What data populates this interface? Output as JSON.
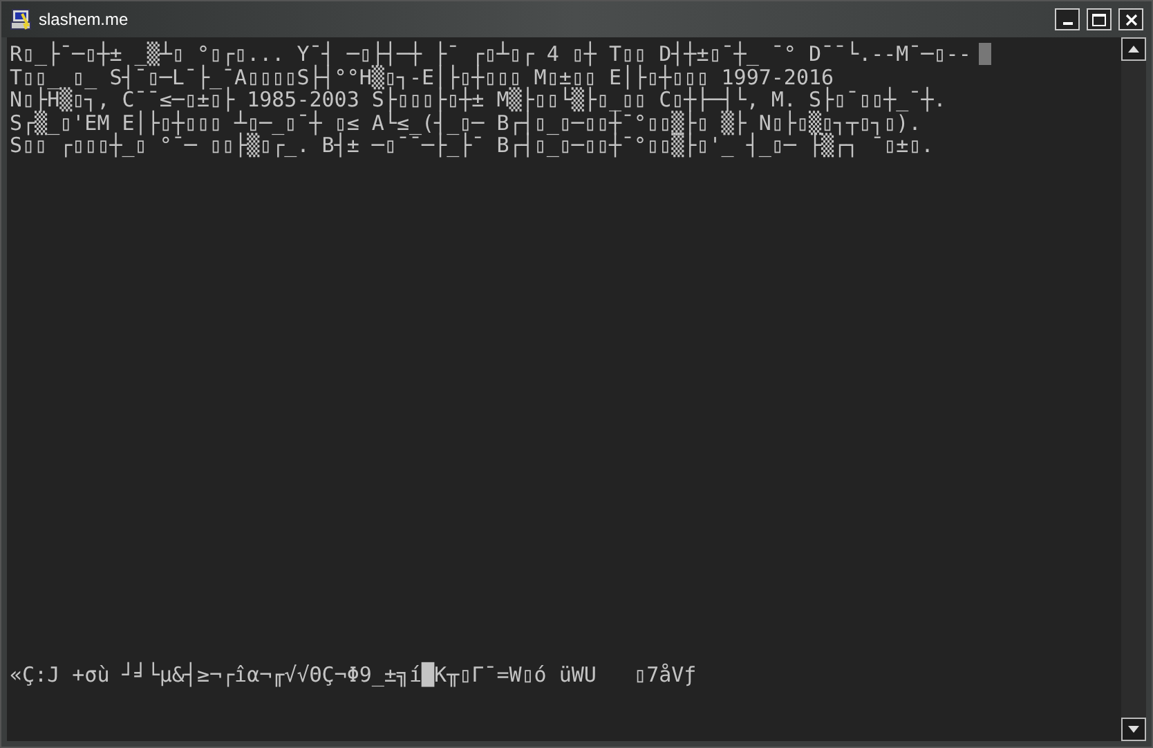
{
  "window": {
    "title": "slashem.me"
  },
  "terminal": {
    "lines": [
      "R▯_├¯─▯┼± _▒┴▯ °▯┌▯... Y¯┤ ─▯├┤─┼ ├¯ ┌▯┴▯┌ 4 ▯┼ T▯▯ D┤┼±▯¯┼_ ¯° D¯¯└.--M¯─▯--",
      "T▯▯_ ▯_ S┤¯▯─L¯├_¯A▯▯▯▯S├┤°°H▒▯┐-E│├▯┼▯▯▯ M▯±▯▯ E│├▯┼▯▯▯ 1997-2016",
      "N▯├H▒▯┐, C¯¯≤─▯±▯├ 1985-2003 S├▯▯▯├▯┼± M▒├▯▯└▒├▯_▯▯ C▯┼├─┤└, M. S├▯¯▯▯┼_¯┼.",
      "S┌▒_▯'EM E│├▯┼▯▯▯ ┴▯─_▯¯┼ ▯≤ A└≤_(┤_▯─ B┌┤▯_▯─▯▯┼¯°▯▯▒├▯ ▒├ N▯├▯▒▯┐┬▯┐▯).",
      "S▯▯ ┌▯▯▯┼_▯ °¯─ ▯▯├▒▯┌_. B┤± ─▯¯¯─├_├¯ B┌┤▯_▯─▯▯┼¯°▯▯▒├▯'_ ┤_▯─ ├▒┌┐ ¯▯±▯."
    ],
    "bottom_line": "«Ç:J +σù ┘╛└µ&┤≥¬┌îα¬╓√√ΘÇ¬Φ9_±╗í█K╥▯Γ¯=W▯ó üWU   ▯7åVƒ"
  }
}
